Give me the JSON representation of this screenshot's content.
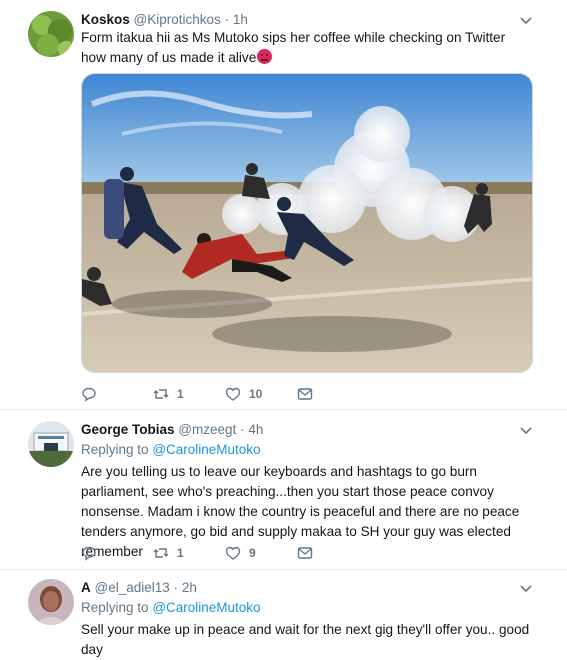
{
  "tweets": [
    {
      "name": "Koskos",
      "handle": "@Kiprotichkos",
      "sep": "·",
      "time": "1h",
      "text": "Form itakua hii as Ms Mutoko sips her coffee while checking on Twitter how many of us made it alive",
      "emoji": "😡",
      "reply_count": "",
      "retweet_count": "1",
      "like_count": "10"
    },
    {
      "name": "George Tobias",
      "handle": "@mzeegt",
      "sep": "·",
      "time": "4h",
      "replying_label": "Replying to",
      "replying_to": "@CarolineMutoko",
      "text": "Are you telling us to leave our keyboards and hashtags to go burn parliament, see who's preaching...then you start those peace convoy nonsense. Madam i know the country is peaceful and there are no peace tenders anymore, go bid and supply makaa to SH your guy was elected remember",
      "reply_count": "",
      "retweet_count": "1",
      "like_count": "9"
    },
    {
      "name": "A",
      "handle": "@el_adiel13",
      "sep": "·",
      "time": "2h",
      "replying_label": "Replying to",
      "replying_to": "@CarolineMutoko",
      "text": "Sell your make up in peace and wait for the next gig they'll offer you.. good day"
    }
  ],
  "colors": {
    "link": "#1b95e0",
    "muted": "#657786",
    "text": "#14171a",
    "emoji_red": "#e0245e"
  },
  "icons": [
    "chevron-down-icon",
    "reply-icon",
    "retweet-icon",
    "like-icon",
    "direct-message-icon"
  ]
}
